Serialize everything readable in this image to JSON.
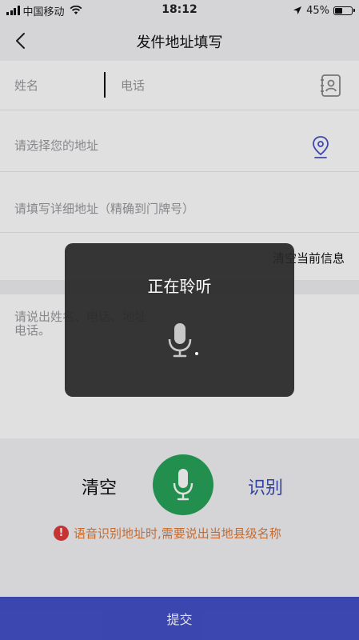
{
  "status_bar": {
    "carrier": "中国移动",
    "time": "18:12",
    "battery_text": "45%",
    "battery_level": 0.45
  },
  "nav": {
    "title": "发件地址填写"
  },
  "form": {
    "name_placeholder": "姓名",
    "phone_placeholder": "电话",
    "address_placeholder": "请选择您的地址",
    "detail_placeholder": "请填写详细地址（精确到门牌号）"
  },
  "clear_info_label": "清空当前信息",
  "voice_input": {
    "placeholder": "请说出姓名、电话、地址\n电话。"
  },
  "controls": {
    "clear_label": "清空",
    "recognize_label": "识别",
    "tip_icon": "!",
    "tip_text": "语音识别地址时,需要说出当地县级名称"
  },
  "submit_label": "提交",
  "listening_popup": {
    "title": "正在聆听"
  },
  "colors": {
    "accent": "#4451c8",
    "mic_green": "#28a35a",
    "tip_orange": "#e07a3a",
    "tip_red": "#e23b3b"
  }
}
